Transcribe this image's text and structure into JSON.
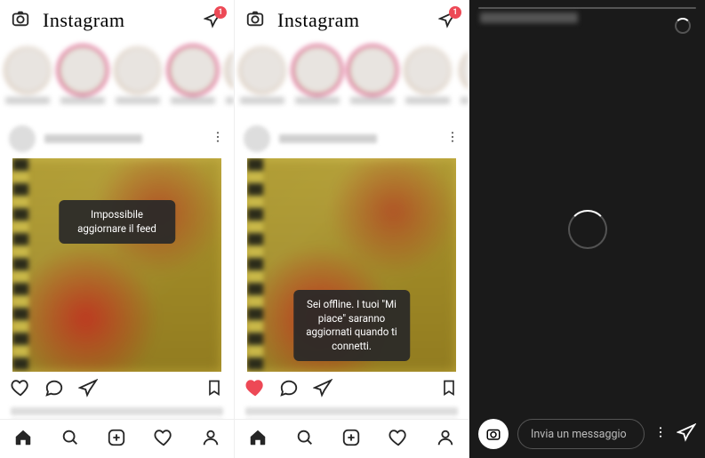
{
  "app_name": "Instagram",
  "message_badge": "1",
  "toast_feed": "Impossibile aggiornare il feed",
  "toast_like": "Sei offline. I tuoi \"Mi piace\" saranno aggiornati quando ti connetti.",
  "story_reply_placeholder": "Invia un messaggio",
  "nav": {
    "home": "home",
    "search": "search",
    "add": "add",
    "activity": "activity",
    "profile": "profile"
  },
  "icons": {
    "camera": "camera-icon",
    "messages": "messages-icon",
    "heart": "heart-icon",
    "comment": "comment-icon",
    "share": "share-icon",
    "bookmark": "bookmark-icon",
    "more": "more-icon",
    "reload": "reload-icon"
  }
}
